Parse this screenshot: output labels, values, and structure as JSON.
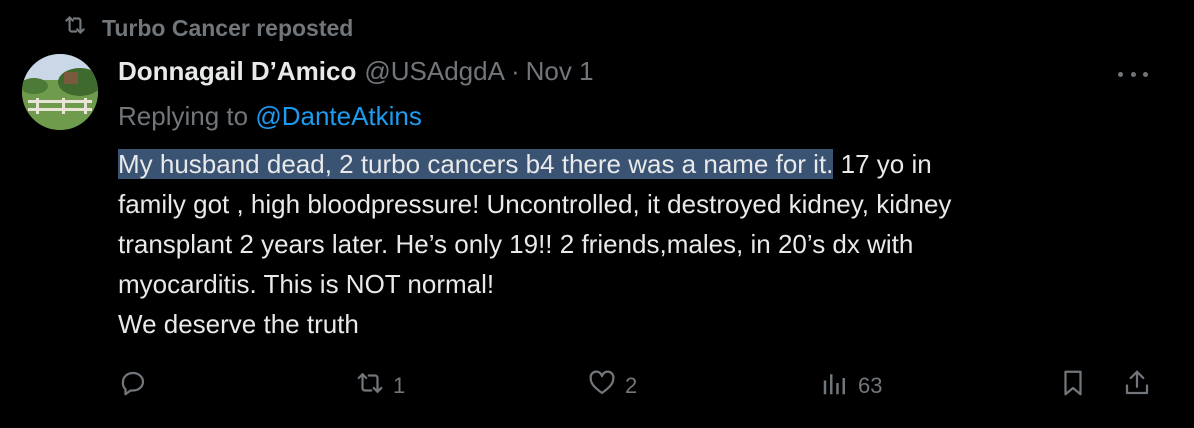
{
  "repost": {
    "label": "Turbo Cancer reposted",
    "icon": "repost-icon"
  },
  "tweet": {
    "author": {
      "display_name": "Donnagail D’Amico",
      "handle": "@USAdgdA",
      "separator": "·",
      "date": "Nov 1"
    },
    "replying_prefix": "Replying to ",
    "replying_to": "@DanteAtkins",
    "text": {
      "line1_highlighted": "My husband dead, 2 turbo cancers b4 there was a name for it.",
      "line1_rest": " 17 yo in",
      "line2": "family got , high bloodpressure! Uncontrolled, it destroyed kidney, kidney",
      "line3": "transplant 2 years later. He’s only 19!! 2 friends,males, in 20’s dx with",
      "line4": "myocarditis. This is NOT normal!",
      "line5": "We deserve the truth"
    },
    "highlight_color": "#3b5373"
  },
  "actions": {
    "reply": {
      "icon": "reply-icon",
      "count": ""
    },
    "repost": {
      "icon": "repost-icon",
      "count": "1"
    },
    "like": {
      "icon": "heart-icon",
      "count": "2"
    },
    "views": {
      "icon": "views-icon",
      "count": "63"
    },
    "bookmark": {
      "icon": "bookmark-icon"
    },
    "share": {
      "icon": "share-icon"
    }
  },
  "colors": {
    "background": "#000000",
    "text": "#e7e9ea",
    "muted": "#71767b",
    "link": "#1d9bf0"
  }
}
